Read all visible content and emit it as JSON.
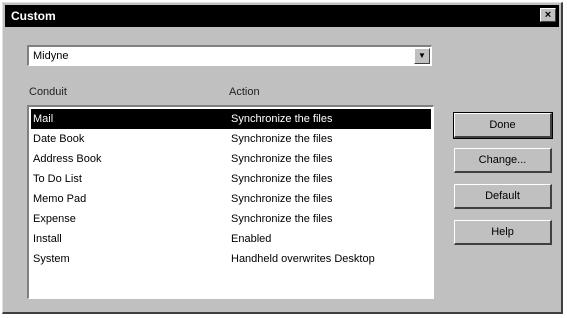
{
  "window": {
    "title": "Custom",
    "close_label": "×"
  },
  "combo": {
    "value": "Midyne"
  },
  "columns": {
    "conduit": "Conduit",
    "action": "Action"
  },
  "rows": [
    {
      "conduit": "Mail",
      "action": "Synchronize the files",
      "selected": true
    },
    {
      "conduit": "Date Book",
      "action": "Synchronize the files"
    },
    {
      "conduit": "Address Book",
      "action": "Synchronize the files"
    },
    {
      "conduit": "To Do List",
      "action": "Synchronize the files"
    },
    {
      "conduit": "Memo Pad",
      "action": "Synchronize the files"
    },
    {
      "conduit": "Expense",
      "action": "Synchronize the files"
    },
    {
      "conduit": "Install",
      "action": "Enabled"
    },
    {
      "conduit": "System",
      "action": "Handheld overwrites Desktop"
    }
  ],
  "buttons": {
    "done": "Done",
    "change": "Change...",
    "default": "Default",
    "help": "Help"
  }
}
